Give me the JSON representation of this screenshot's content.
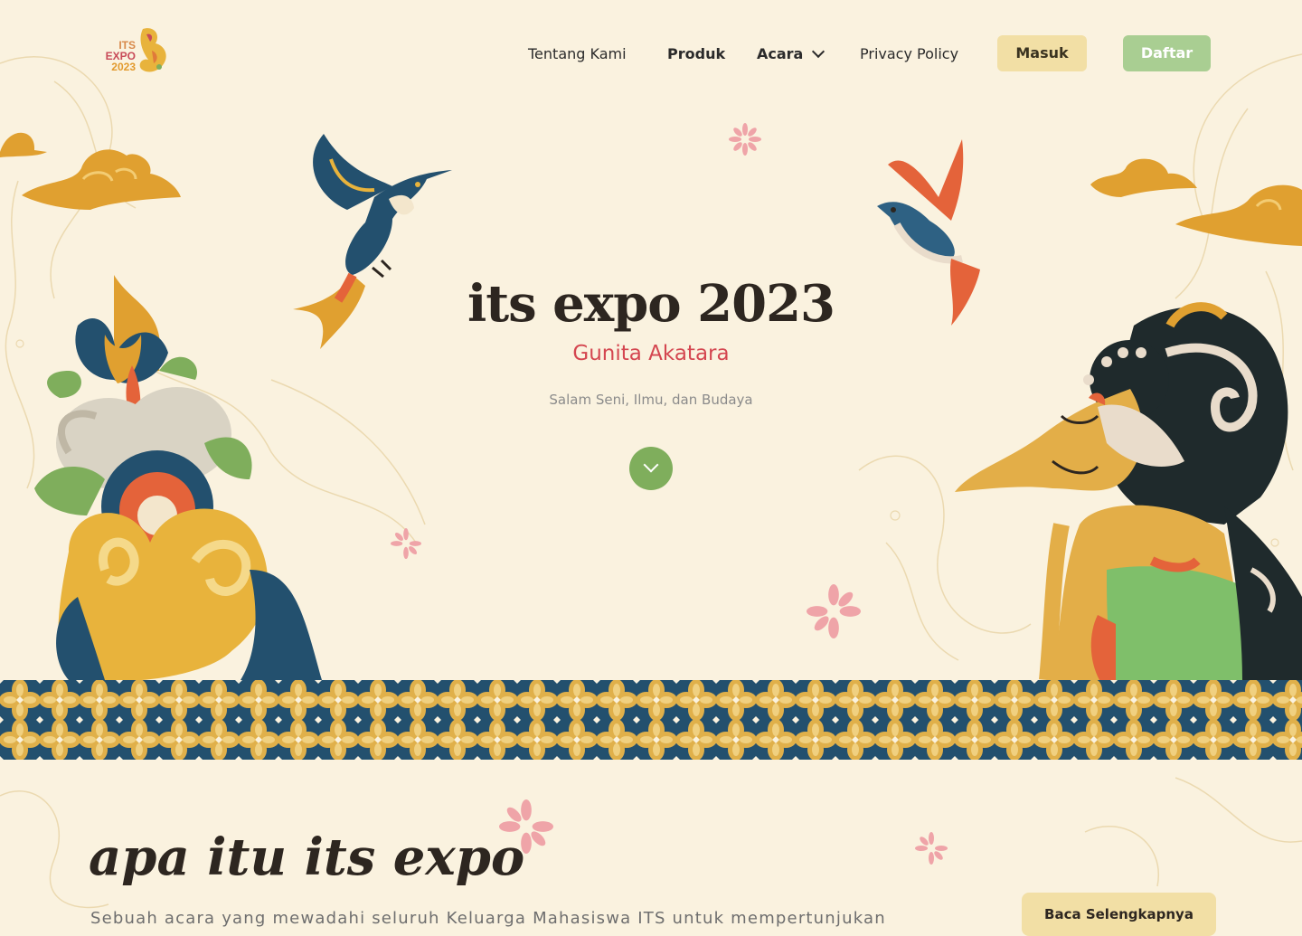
{
  "header": {
    "logo": {
      "line1": "ITS",
      "line2": "EXPO",
      "line3": "2023"
    },
    "nav": [
      {
        "label": "Tentang Kami"
      },
      {
        "label": "Produk"
      },
      {
        "label": "Acara"
      },
      {
        "label": "Privacy Policy"
      }
    ],
    "login_label": "Masuk",
    "register_label": "Daftar"
  },
  "hero": {
    "title": "its expo 2023",
    "subtitle": "Gunita Akatara",
    "tagline": "Salam Seni, Ilmu, dan Budaya",
    "scroll_icon": "chevron-down-icon"
  },
  "about": {
    "title": "apa itu its expo",
    "description": "Sebuah acara yang mewadahi seluruh Keluarga Mahasiswa ITS untuk mempertunjukan",
    "read_more_label": "Baca Selengkapnya"
  },
  "colors": {
    "background": "#FAF2DF",
    "accent_red": "#D44650",
    "accent_green": "#7FAE5C",
    "button_yellow": "#F2DFA5",
    "button_green": "#A9CE92",
    "batik_gold": "#E0B04A",
    "batik_blue": "#23506E"
  }
}
